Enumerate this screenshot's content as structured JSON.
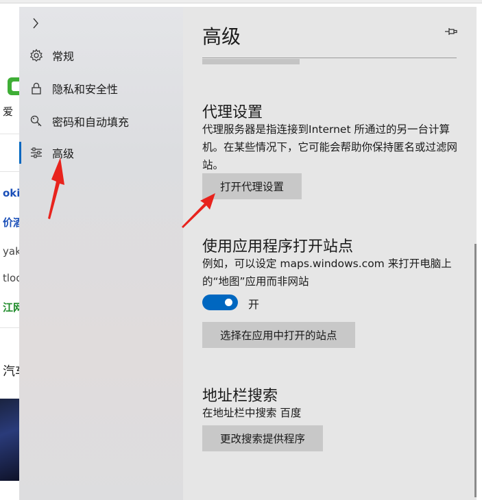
{
  "background_page": {
    "snippets": [
      {
        "text": "爱"
      },
      {
        "text": "okin"
      },
      {
        "text": "价酒"
      },
      {
        "text": "yak国"
      },
      {
        "text": "tloo"
      },
      {
        "text": "江网"
      },
      {
        "text": "汽车"
      }
    ]
  },
  "sidebar": {
    "toggle_icon": "chevron-right-icon",
    "items": [
      {
        "label": "常规",
        "icon": "gear-icon"
      },
      {
        "label": "隐私和安全性",
        "icon": "lock-icon"
      },
      {
        "label": "密码和自动填充",
        "icon": "key-icon"
      },
      {
        "label": "高级",
        "icon": "sliders-icon",
        "active": true
      }
    ]
  },
  "main": {
    "title": "高级",
    "pin_icon": "pin-icon",
    "proxy": {
      "title": "代理设置",
      "description": "代理服务器是指连接到Internet 所通过的另一台计算机。在某些情况下，它可能会帮助你保持匿名或过滤网站。",
      "button": "打开代理设置"
    },
    "open_sites": {
      "title": "使用应用程序打开站点",
      "description": "例如，可以设定 maps.windows.com 来打开电脑上的“地图”应用而非网站",
      "toggle_label": "开",
      "toggle_on": true,
      "button": "选择在应用中打开的站点"
    },
    "address_bar": {
      "title": "地址栏搜索",
      "description": "在地址栏中搜索 百度",
      "button": "更改搜索提供程序"
    }
  },
  "colors": {
    "accent": "#0067c0",
    "annotation": "#e8231d"
  }
}
